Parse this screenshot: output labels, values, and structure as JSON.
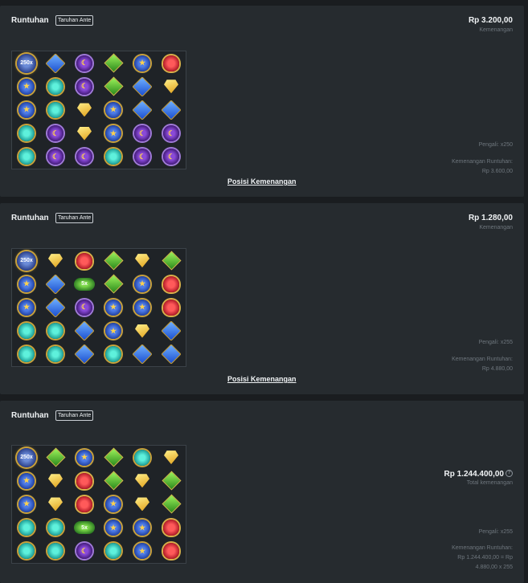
{
  "panels": [
    {
      "title": "Runtuhan",
      "badge": "Taruhan Ante",
      "amount": "Rp 3.200,00",
      "amount_label": "Kemenangan",
      "multiplier": "Pengali: x250",
      "cascade_label": "Kemenangan Runtuhan:",
      "cascade_value": "Rp 3.600,00",
      "cascade_formula": "",
      "link": "Posisi Kemenangan",
      "grid": [
        [
          "scatter:250x",
          "blue",
          "purple",
          "green",
          "blue-star",
          "red"
        ],
        [
          "blue-star",
          "teal",
          "purple",
          "green",
          "blue",
          "yellow"
        ],
        [
          "blue-star",
          "teal",
          "yellow",
          "blue-star",
          "blue",
          "blue"
        ],
        [
          "teal",
          "purple",
          "yellow",
          "blue-star",
          "purple",
          "purple"
        ],
        [
          "teal",
          "purple",
          "purple",
          "teal",
          "purple",
          "purple"
        ]
      ]
    },
    {
      "title": "Runtuhan",
      "badge": "Taruhan Ante",
      "amount": "Rp 1.280,00",
      "amount_label": "Kemenangan",
      "multiplier": "Pengali: x255",
      "cascade_label": "Kemenangan Runtuhan:",
      "cascade_value": "Rp 4.880,00",
      "cascade_formula": "",
      "link": "Posisi Kemenangan",
      "grid": [
        [
          "scatter:250x",
          "yellow",
          "red",
          "green",
          "yellow",
          "green"
        ],
        [
          "blue-star",
          "blue",
          "mult:5x",
          "green",
          "blue-star",
          "red"
        ],
        [
          "blue-star",
          "blue",
          "purple",
          "blue-star",
          "blue-star",
          "red"
        ],
        [
          "teal",
          "teal",
          "blue",
          "blue-star",
          "yellow",
          "blue"
        ],
        [
          "teal",
          "teal",
          "blue",
          "teal",
          "blue",
          "blue"
        ]
      ]
    },
    {
      "title": "Runtuhan",
      "badge": "Taruhan Ante",
      "amount": "Rp 1.244.400,00",
      "amount_label": "Total kemenangan",
      "info_icon": "?",
      "multiplier": "Pengali: x255",
      "cascade_label": "Kemenangan Runtuhan:",
      "cascade_value": "Rp 1.244.400,00 = Rp",
      "cascade_formula": "4.880,00 x 255",
      "link": "",
      "grid": [
        [
          "scatter:250x",
          "green",
          "blue-star",
          "green",
          "teal",
          "yellow"
        ],
        [
          "blue-star",
          "yellow",
          "red",
          "green",
          "yellow",
          "green"
        ],
        [
          "blue-star",
          "yellow",
          "red",
          "blue-star",
          "yellow",
          "green"
        ],
        [
          "teal",
          "teal",
          "mult:5x",
          "blue-star",
          "blue-star",
          "red"
        ],
        [
          "teal",
          "teal",
          "purple",
          "teal",
          "blue-star",
          "red"
        ]
      ]
    }
  ],
  "symbol_icons": {
    "blue-star": "blue-star-gem-icon",
    "blue": "blue-diamond-gem-icon",
    "purple": "purple-moon-gem-icon",
    "green": "green-gem-icon",
    "yellow": "yellow-gem-icon",
    "red": "red-heart-gem-icon",
    "teal": "teal-round-gem-icon",
    "scatter": "multiplier-orb-icon",
    "mult": "winged-multiplier-icon"
  },
  "colors": {
    "panel_bg": "#262b2f",
    "page_bg": "#1a1d20",
    "text_primary": "#f0f3f5",
    "text_muted": "#6e767d"
  }
}
